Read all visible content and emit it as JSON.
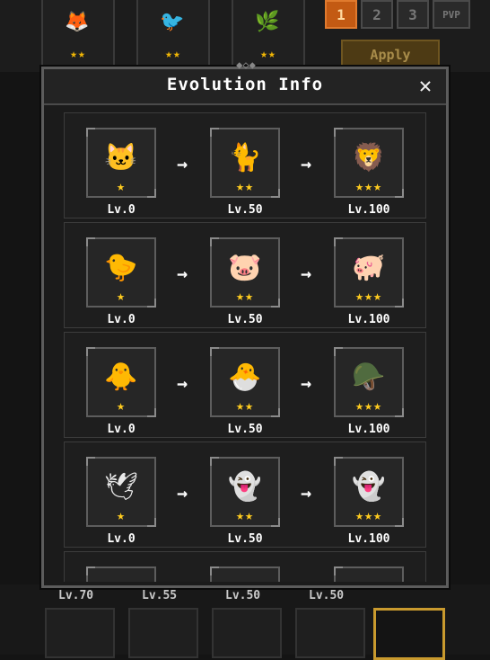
{
  "top_slots": [
    {
      "pet_icon": "fox-pet-icon",
      "glyph": "🦊",
      "stars": "★★"
    },
    {
      "pet_icon": "bird-pet-icon",
      "glyph": "🐦",
      "stars": "★★"
    },
    {
      "pet_icon": "leaf-pet-icon",
      "glyph": "🌿",
      "stars": "★★"
    }
  ],
  "tabs": [
    "1",
    "2",
    "3",
    "PVP"
  ],
  "active_tab": "1",
  "apply_label": "Apply",
  "modal": {
    "title": "Evolution Info",
    "close_icon": "close-icon",
    "rows": [
      {
        "stages": [
          {
            "icon": "pink-cat-icon",
            "glyph": "🐱",
            "stars": "★",
            "level": "Lv.0"
          },
          {
            "icon": "pink-cat-icon",
            "glyph": "🐈",
            "stars": "★★",
            "level": "Lv.50"
          },
          {
            "icon": "winged-cat-icon",
            "glyph": "🦁",
            "stars": "★★★",
            "level": "Lv.100"
          }
        ]
      },
      {
        "stages": [
          {
            "icon": "yellow-pig-icon",
            "glyph": "🐤",
            "stars": "★",
            "level": "Lv.0"
          },
          {
            "icon": "yellow-pig-icon",
            "glyph": "🐷",
            "stars": "★★",
            "level": "Lv.50"
          },
          {
            "icon": "winged-pig-icon",
            "glyph": "🐖",
            "stars": "★★★",
            "level": "Lv.100"
          }
        ]
      },
      {
        "stages": [
          {
            "icon": "chick-icon",
            "glyph": "🐥",
            "stars": "★",
            "level": "Lv.0"
          },
          {
            "icon": "helmet-chick-icon",
            "glyph": "🐣",
            "stars": "★★",
            "level": "Lv.50"
          },
          {
            "icon": "knight-chick-icon",
            "glyph": "🪖",
            "stars": "★★★",
            "level": "Lv.100"
          }
        ]
      },
      {
        "stages": [
          {
            "icon": "ghost-icon",
            "glyph": "🕊",
            "stars": "★",
            "level": "Lv.0"
          },
          {
            "icon": "ghost-icon",
            "glyph": "👻",
            "stars": "★★",
            "level": "Lv.50"
          },
          {
            "icon": "ghost-icon",
            "glyph": "👻",
            "stars": "★★★",
            "level": "Lv.100"
          }
        ]
      },
      {
        "stages": [
          {
            "icon": "pet-icon",
            "glyph": "",
            "stars": "",
            "level": ""
          },
          {
            "icon": "pet-icon",
            "glyph": "",
            "stars": "",
            "level": ""
          },
          {
            "icon": "pet-icon",
            "glyph": "",
            "stars": "",
            "level": ""
          }
        ]
      }
    ]
  },
  "bottom": {
    "levels": [
      "Lv.70",
      "Lv.55",
      "Lv.50",
      "Lv.50"
    ]
  }
}
